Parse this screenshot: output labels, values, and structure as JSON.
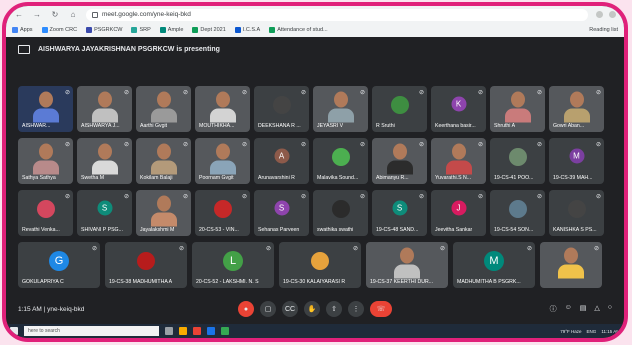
{
  "browser": {
    "url": "meet.google.com/yne-keiq-bkd",
    "bookmarks": [
      "Apps",
      "Zoom CRC",
      "PSGRKCW",
      "SRP",
      "Ample",
      "Dept 2021",
      "I.C.S.A",
      "Attendance of stud..."
    ],
    "bookmarks_right": "Reading list"
  },
  "banner": {
    "text": "AISHWARYA JAYAKRISHNAN PSGRKCW is presenting"
  },
  "rows": [
    [
      {
        "name": "AISHWAR...",
        "type": "screen",
        "color": "#5b7bd5"
      },
      {
        "name": "AISHWARYA J...",
        "type": "face",
        "color": "#c0c0c0"
      },
      {
        "name": "Aarthi Gvgit",
        "type": "face",
        "color": "#9a9a9a"
      },
      {
        "name": "MOUTHIKHA...",
        "type": "face",
        "color": "#d3d3d3"
      },
      {
        "name": "DEEKSHANA R ...",
        "type": "photo",
        "color": "#444444"
      },
      {
        "name": "JEYASRI V",
        "type": "face",
        "color": "#8ea0a8"
      },
      {
        "name": "R Sruthi",
        "type": "photo",
        "color": "#3e8e41"
      },
      {
        "name": "Keerthana basir...",
        "type": "avatar",
        "letter": "K",
        "color": "#8e44ad"
      },
      {
        "name": "Shruthi A",
        "type": "face",
        "color": "#c97b7b"
      },
      {
        "name": "Gowri Aban...",
        "type": "face",
        "color": "#b8a06e"
      }
    ],
    [
      {
        "name": "Sathya Sathya",
        "type": "face",
        "color": "#b88a8a"
      },
      {
        "name": "Swetha M",
        "type": "face",
        "color": "#d9d9d9"
      },
      {
        "name": "Kokilam Balaji",
        "type": "face",
        "color": "#b39a7a"
      },
      {
        "name": "Poornam Gvgit",
        "type": "face",
        "color": "#8aa4b8"
      },
      {
        "name": "Arunavarshini R",
        "type": "avatar",
        "letter": "A",
        "color": "#8d5a4a"
      },
      {
        "name": "Malavika Sound...",
        "type": "photo",
        "color": "#4caf50"
      },
      {
        "name": "Abimanyu R...",
        "type": "face",
        "color": "#2c2c2c"
      },
      {
        "name": "Yuvarathi.S N...",
        "type": "face",
        "color": "#c44a4a"
      },
      {
        "name": "19-CS-41 POO...",
        "type": "photo",
        "color": "#6d8a6d"
      },
      {
        "name": "19-CS-39 MAH...",
        "type": "avatar",
        "letter": "M",
        "color": "#7b3fa0"
      }
    ],
    [
      {
        "name": "Revathi Venka...",
        "type": "photo",
        "color": "#d4475e"
      },
      {
        "name": "SHIVANI P PSG...",
        "type": "avatar",
        "letter": "S",
        "color": "#0e8c7a"
      },
      {
        "name": "Jayalakshmi M",
        "type": "face",
        "color": "#c48a6a"
      },
      {
        "name": "20-CS-53 - VIN...",
        "type": "photo",
        "color": "#c62828"
      },
      {
        "name": "Sehanas Parveen",
        "type": "avatar",
        "letter": "S",
        "color": "#8e44ad"
      },
      {
        "name": "swathika swathi",
        "type": "photo",
        "color": "#2b2b2b"
      },
      {
        "name": "19-CS-48 SAND...",
        "type": "avatar",
        "letter": "S",
        "color": "#0e8c7a"
      },
      {
        "name": "Jeevitha Sankar",
        "type": "avatar",
        "letter": "J",
        "color": "#d81b60"
      },
      {
        "name": "19-CS-54 SON...",
        "type": "photo",
        "color": "#5d7a8c"
      },
      {
        "name": "KANISHKA S PS...",
        "type": "photo",
        "color": "#444444"
      }
    ],
    [
      {
        "name": "GOKULAPRIYA C",
        "type": "avatar",
        "letter": "G",
        "color": "#1e88e5"
      },
      {
        "name": "19-CS-38 MADHUMITHA A",
        "type": "photo",
        "color": "#b71c1c"
      },
      {
        "name": "20-CS-52 - LAKSHMI. N. S",
        "type": "avatar",
        "letter": "L",
        "color": "#43a047"
      },
      {
        "name": "19-CS-30 KALAIYARASI R",
        "type": "photo",
        "color": "#e6a23c"
      },
      {
        "name": "19-CS-37 KEERTHI DUR...",
        "type": "face",
        "color": "#c0c0c0"
      },
      {
        "name": "MADHUMITHA B PSGRK...",
        "type": "avatar",
        "letter": "M",
        "color": "#00897b"
      },
      {
        "name": "",
        "type": "face",
        "color": "#f0c24a"
      }
    ]
  ],
  "bottom": {
    "meeting": "1:15 AM | yne-keiq-bkd"
  },
  "controls": [
    "mic-off-icon",
    "camera-off-icon",
    "captions-icon",
    "raise-hand-icon",
    "present-icon",
    "more-icon",
    "hang-up-icon"
  ],
  "taskbar": {
    "search_placeholder": "here to search",
    "weather": "79°F Haze",
    "lang": "ENG",
    "time": "11:15 AM"
  }
}
